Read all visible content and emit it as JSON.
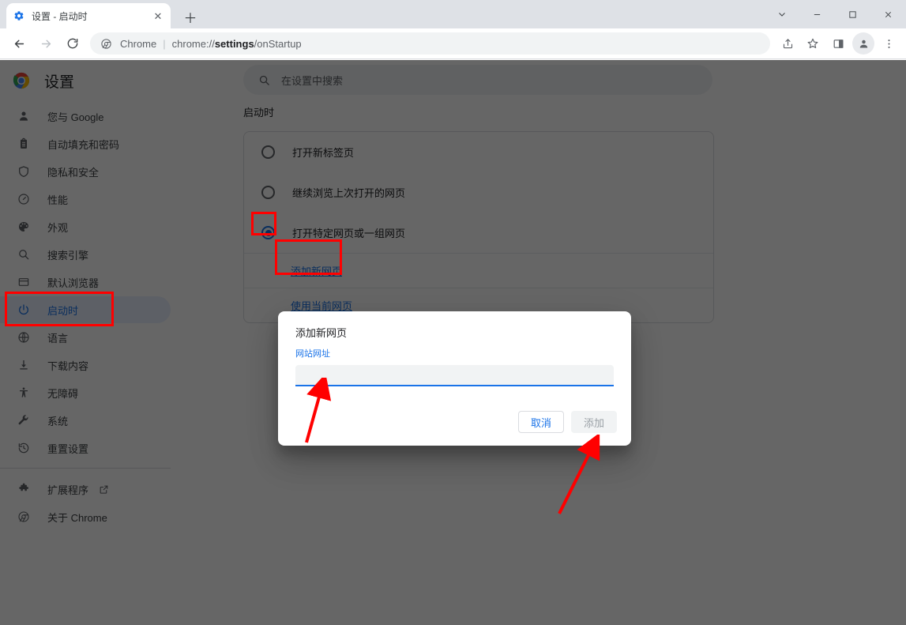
{
  "browser": {
    "tab": {
      "favicon": "gear-icon",
      "title": "设置 - 启动时",
      "close_label": "✕"
    },
    "new_tab_label": "＋",
    "window_controls": {
      "collapse": "⌄",
      "minimize": "—",
      "maximize": "□",
      "close": "✕"
    },
    "nav": {
      "back": "back-arrow-icon",
      "forward": "forward-arrow-icon",
      "reload": "reload-icon"
    },
    "omnibox": {
      "chip": "Chrome",
      "separator": "|",
      "url_scheme": "chrome://",
      "url_rest_bold": "settings",
      "url_tail": "/onStartup"
    },
    "toolbar_icons": [
      "share-icon",
      "bookmark-star-icon",
      "side-panel-icon",
      "profile-avatar-icon",
      "menu-dots-icon"
    ]
  },
  "settings": {
    "logo": "chrome-logo-icon",
    "title": "设置",
    "search": {
      "icon": "search-icon",
      "placeholder": "在设置中搜索"
    },
    "sidebar": {
      "items": [
        {
          "icon": "person-icon",
          "label": "您与 Google",
          "active": false
        },
        {
          "icon": "clipboard-icon",
          "label": "自动填充和密码",
          "active": false
        },
        {
          "icon": "shield-icon",
          "label": "隐私和安全",
          "active": false
        },
        {
          "icon": "gauge-icon",
          "label": "性能",
          "active": false
        },
        {
          "icon": "palette-icon",
          "label": "外观",
          "active": false
        },
        {
          "icon": "search-icon",
          "label": "搜索引擎",
          "active": false
        },
        {
          "icon": "browser-icon",
          "label": "默认浏览器",
          "active": false
        },
        {
          "icon": "power-icon",
          "label": "启动时",
          "active": true
        },
        {
          "icon": "globe-icon",
          "label": "语言",
          "active": false
        },
        {
          "icon": "download-icon",
          "label": "下载内容",
          "active": false
        },
        {
          "icon": "accessibility-icon",
          "label": "无障碍",
          "active": false
        },
        {
          "icon": "wrench-icon",
          "label": "系统",
          "active": false
        },
        {
          "icon": "history-icon",
          "label": "重置设置",
          "active": false
        }
      ],
      "footer_items": [
        {
          "icon": "puzzle-icon",
          "label": "扩展程序",
          "external": true
        },
        {
          "icon": "chrome-ring-icon",
          "label": "关于 Chrome",
          "external": false
        }
      ]
    },
    "main": {
      "section_title": "启动时",
      "options": [
        {
          "label": "打开新标签页",
          "checked": false
        },
        {
          "label": "继续浏览上次打开的网页",
          "checked": false
        },
        {
          "label": "打开特定网页或一组网页",
          "checked": true
        }
      ],
      "links": [
        {
          "label": "添加新网页"
        },
        {
          "label": "使用当前网页"
        }
      ]
    }
  },
  "dialog": {
    "title": "添加新网页",
    "field_label": "网站网址",
    "input_value": "",
    "input_placeholder": "",
    "cancel_label": "取消",
    "add_label": "添加",
    "add_disabled": true
  },
  "annotations": {
    "color": "#ff0000",
    "boxes": [
      {
        "name": "radio-highlight",
        "target": "打开特定网页或一组网页 radio"
      },
      {
        "name": "add-new-page-highlight",
        "target": "添加新网页 link"
      },
      {
        "name": "startup-nav-highlight",
        "target": "启动时 sidebar item"
      }
    ],
    "arrows": [
      {
        "name": "arrow-to-url-input",
        "target": "网站网址 input"
      },
      {
        "name": "arrow-to-add-button",
        "target": "添加 button"
      }
    ]
  }
}
